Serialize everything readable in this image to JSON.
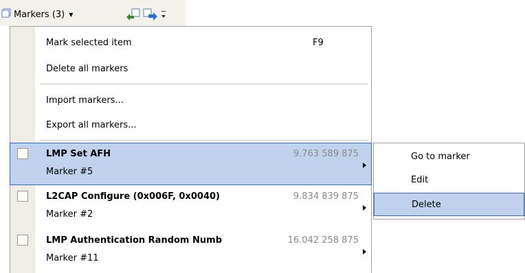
{
  "toolbar": {
    "markers_label": "Markers (3)",
    "icons": [
      "markers-icon",
      "dropdown-arrow-icon",
      "previous-marker-icon",
      "next-marker-icon",
      "toolbar-overflow-icon"
    ]
  },
  "menu": {
    "mark_selected": {
      "label": "Mark selected item",
      "shortcut": "F9"
    },
    "delete_all": {
      "label": "Delete all markers"
    },
    "import": {
      "label": "Import markers..."
    },
    "export": {
      "label": "Export all markers..."
    },
    "markers": [
      {
        "name": "LMP Set AFH",
        "sub": "Marker #5",
        "time": "9.763 589 875"
      },
      {
        "name": "L2CAP Configure (0x006F, 0x0040)",
        "sub": "Marker #2",
        "time": "9.834 839 875"
      },
      {
        "name": "LMP Authentication Random Numb",
        "sub": "Marker #11",
        "time": "16.042 258 875"
      }
    ]
  },
  "submenu": {
    "items": [
      {
        "label": "Go to marker"
      },
      {
        "label": "Edit"
      },
      {
        "label": "Delete"
      }
    ]
  },
  "colors": {
    "selection_bg": "#c1d2ee",
    "selection_border": "#316ac5",
    "gutter": "#efede4",
    "toolbar_bg": "#f3f1ea",
    "time_text": "#8a8a8a"
  }
}
